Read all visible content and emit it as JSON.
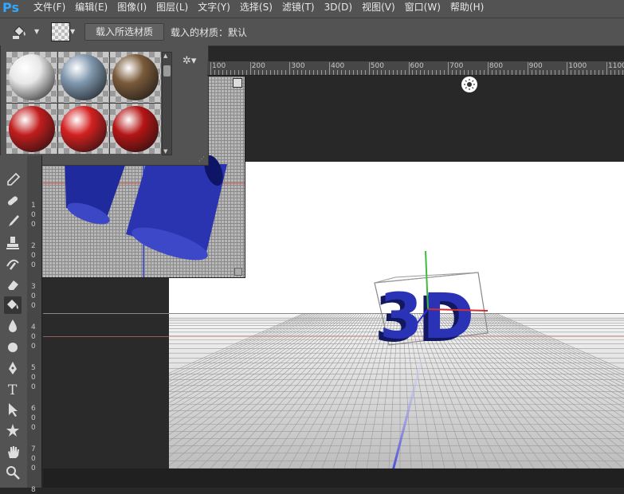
{
  "app": {
    "logo": "Ps"
  },
  "menu": [
    "文件(F)",
    "编辑(E)",
    "图像(I)",
    "图层(L)",
    "文字(Y)",
    "选择(S)",
    "滤镜(T)",
    "3D(D)",
    "视图(V)",
    "窗口(W)",
    "帮助(H)"
  ],
  "options": {
    "tool_icon": "paint-bucket-3d-material-drop-icon",
    "load_selected_button": "载入所选材质",
    "loaded_material_label": "载入的材质：默认"
  },
  "ruler_top": [
    "100",
    "200",
    "300",
    "400",
    "500",
    "600",
    "700",
    "800",
    "900",
    "1000",
    "1100"
  ],
  "ruler_left": [
    "1",
    "0",
    "0",
    "2",
    "0",
    "0",
    "3",
    "0",
    "0",
    "4",
    "0",
    "0",
    "5",
    "0",
    "0",
    "6",
    "0",
    "0",
    "7",
    "0",
    "0",
    "8"
  ],
  "materials": [
    {
      "name": "white-glossy",
      "color": "#e8e8e8"
    },
    {
      "name": "blue-grey",
      "color": "#7f97ad"
    },
    {
      "name": "wood-brown",
      "color": "#7a5a3a"
    },
    {
      "name": "red-fabric",
      "color": "#c21d1d"
    },
    {
      "name": "red-knit",
      "color": "#d42020"
    },
    {
      "name": "red-plaid",
      "color": "#b51515"
    }
  ],
  "tools": [
    "eyedropper-icon",
    "spot-heal-icon",
    "brush-icon",
    "clone-stamp-icon",
    "history-brush-icon",
    "eraser-icon",
    "paint-bucket-icon",
    "blur-icon",
    "dodge-icon",
    "pen-icon",
    "type-icon",
    "path-select-icon",
    "shape-icon",
    "hand-icon",
    "zoom-icon"
  ],
  "colors": {
    "accent": "#31a8ff",
    "model_blue": "#1a1f8a"
  }
}
